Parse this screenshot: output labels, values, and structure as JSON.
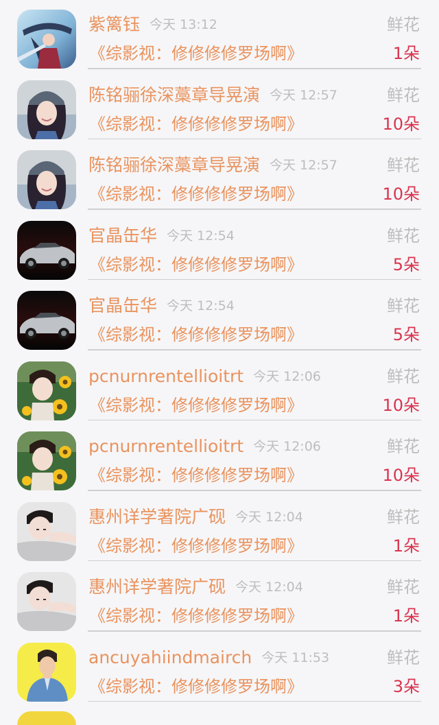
{
  "rows": [
    {
      "avatar": "avatar-anime-swordsman",
      "name": "紫篱钰",
      "time": "今天 13:12",
      "gift": "鲜花",
      "desc": "《综影视：修修修修罗场啊》",
      "count": "1朵"
    },
    {
      "avatar": "avatar-girl-beanie",
      "name": "陈铭骊徐深藁章导晃演",
      "time": "今天 12:57",
      "gift": "鲜花",
      "desc": "《综影视：修修修修罗场啊》",
      "count": "10朵"
    },
    {
      "avatar": "avatar-girl-beanie",
      "name": "陈铭骊徐深藁章导晃演",
      "time": "今天 12:57",
      "gift": "鲜花",
      "desc": "《综影视：修修修修罗场啊》",
      "count": "10朵"
    },
    {
      "avatar": "avatar-silver-car",
      "name": "官晶缶华",
      "time": "今天 12:54",
      "gift": "鲜花",
      "desc": "《综影视：修修修修罗场啊》",
      "count": "5朵"
    },
    {
      "avatar": "avatar-silver-car",
      "name": "官晶缶华",
      "time": "今天 12:54",
      "gift": "鲜花",
      "desc": "《综影视：修修修修罗场啊》",
      "count": "5朵"
    },
    {
      "avatar": "avatar-sunflower-boy",
      "name": "pcnurnrentellioitrt",
      "time": "今天 12:06",
      "gift": "鲜花",
      "desc": "《综影视：修修修修罗场啊》",
      "count": "10朵"
    },
    {
      "avatar": "avatar-sunflower-boy",
      "name": "pcnurnrentellioitrt",
      "time": "今天 12:06",
      "gift": "鲜花",
      "desc": "《综影视：修修修修罗场啊》",
      "count": "10朵"
    },
    {
      "avatar": "avatar-lying-boy",
      "name": "惠州详学著院广砚",
      "time": "今天 12:04",
      "gift": "鲜花",
      "desc": "《综影视：修修修修罗场啊》",
      "count": "1朵"
    },
    {
      "avatar": "avatar-lying-boy",
      "name": "惠州详学著院广砚",
      "time": "今天 12:04",
      "gift": "鲜花",
      "desc": "《综影视：修修修修罗场啊》",
      "count": "1朵"
    },
    {
      "avatar": "avatar-cartoon-denim",
      "name": "ancuyahiindmairch",
      "time": "今天 11:53",
      "gift": "鲜花",
      "desc": "《综影视：修修修修罗场啊》",
      "count": "3朵"
    }
  ],
  "colors": {
    "background": "#f6f6f8",
    "name": "#e9935e",
    "time": "#bdbdbd",
    "count": "#d9344f",
    "divider": "#cfcfd3"
  }
}
